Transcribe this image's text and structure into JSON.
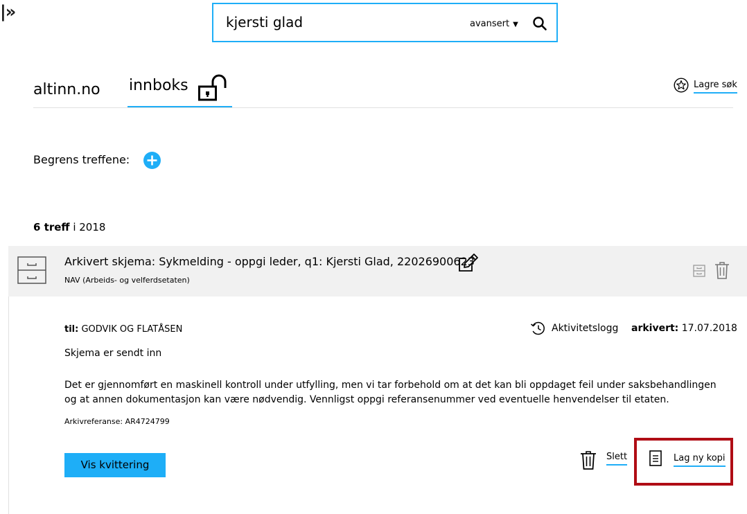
{
  "sidebar": {
    "expand_label": "|»"
  },
  "search": {
    "query": "kjersti glad",
    "advanced_label": "avansert",
    "advanced_caret": "▼"
  },
  "nav": {
    "tabs": [
      {
        "label": "altinn.no",
        "active": false
      },
      {
        "label": "innboks",
        "active": true
      }
    ],
    "save_search_label": "Lagre søk"
  },
  "filter": {
    "label": "Begrens treffene:"
  },
  "results": {
    "count_bold": "6 treff",
    "count_rest": " i 2018"
  },
  "message": {
    "title": "Arkivert skjema: Sykmelding - oppgi leder, q1: Kjersti Glad, 22026900623",
    "sender": "NAV (Arbeids- og velferdsetaten)",
    "to_label": "til:",
    "to_value": " GODVIK OG FLATÅSEN",
    "activity_log_label": "Aktivitetslogg",
    "archived_label": "arkivert:",
    "archived_date": " 17.07.2018",
    "status_text": "Skjema er sendt inn",
    "description": "Det er gjennomført en maskinell kontroll under utfylling, men vi tar forbehold om at det kan bli oppdaget feil under saksbehandlingen og at annen dokumentasjon kan være nødvendig. Vennligst oppgi referansenummer ved eventuelle henvendelser til etaten.",
    "archive_reference": "Arkivreferanse: AR4724799",
    "receipt_button": "Vis kvittering",
    "delete_label": "Slett",
    "copy_label": "Lag ny kopi"
  },
  "colors": {
    "accent": "#1eaef7",
    "highlight_border": "#b00d15",
    "card_header_bg": "#f1f1f1"
  },
  "icons": [
    "search-icon",
    "unlocked-padlock-icon",
    "star-icon",
    "plus-icon",
    "archive-box-icon",
    "edit-icon",
    "trash-icon",
    "history-icon",
    "document-icon"
  ]
}
